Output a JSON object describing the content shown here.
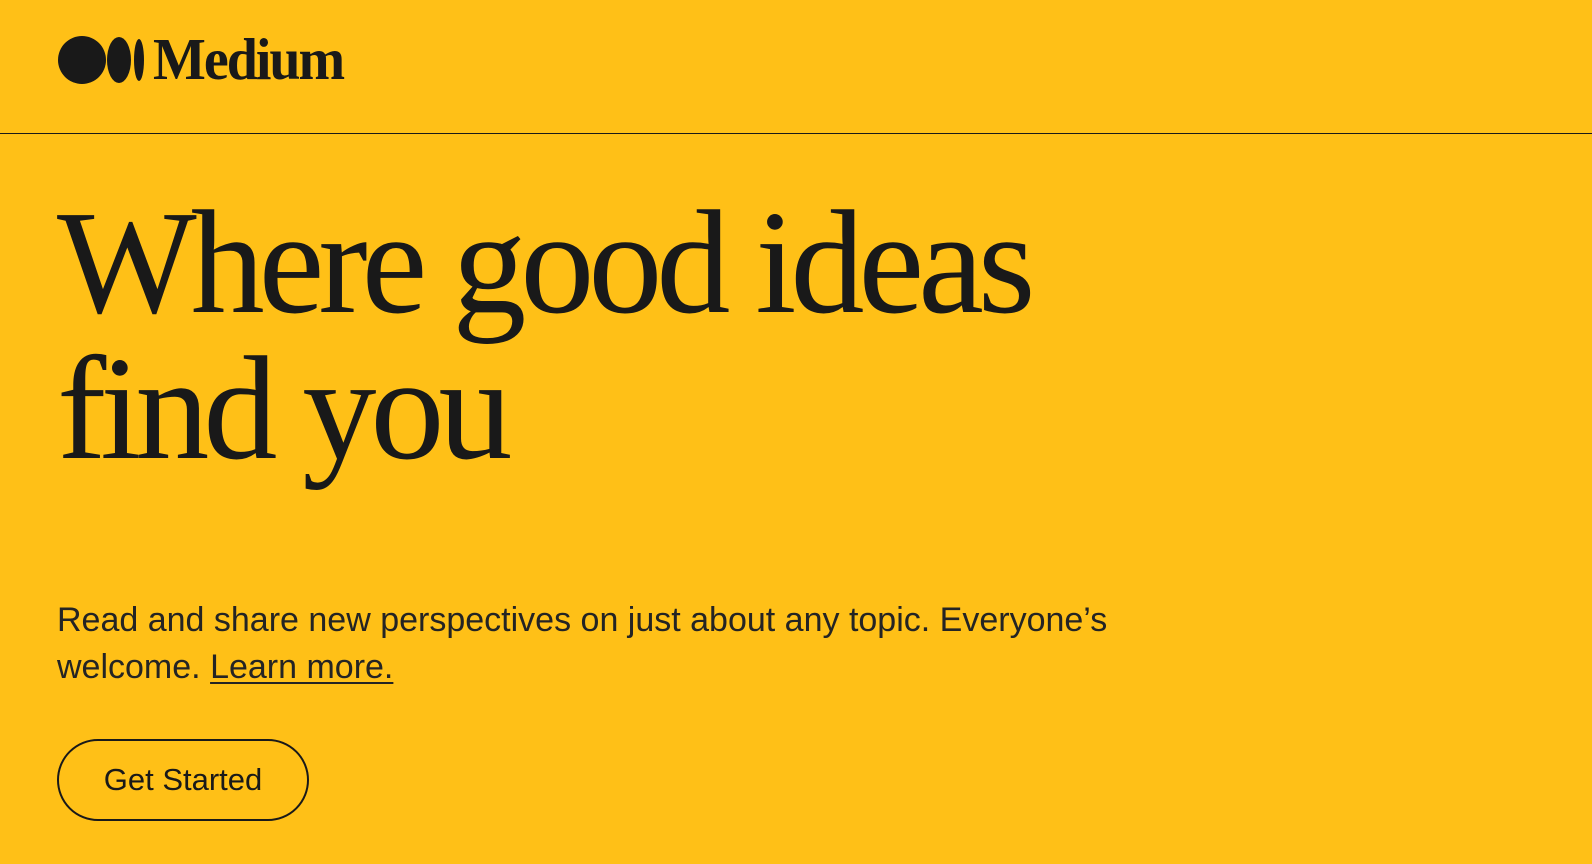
{
  "header": {
    "logo": {
      "icon": "medium-logo-icon",
      "wordmark": "Medium"
    }
  },
  "hero": {
    "title": "Where good ideas find you",
    "subtitle": "Read and share new perspectives on just about any topic. Everyone’s welcome.",
    "learn_more_label": "Learn more.",
    "cta_label": "Get Started"
  },
  "colors": {
    "background": "#FFC017",
    "text": "#191919",
    "divider": "#191919"
  }
}
